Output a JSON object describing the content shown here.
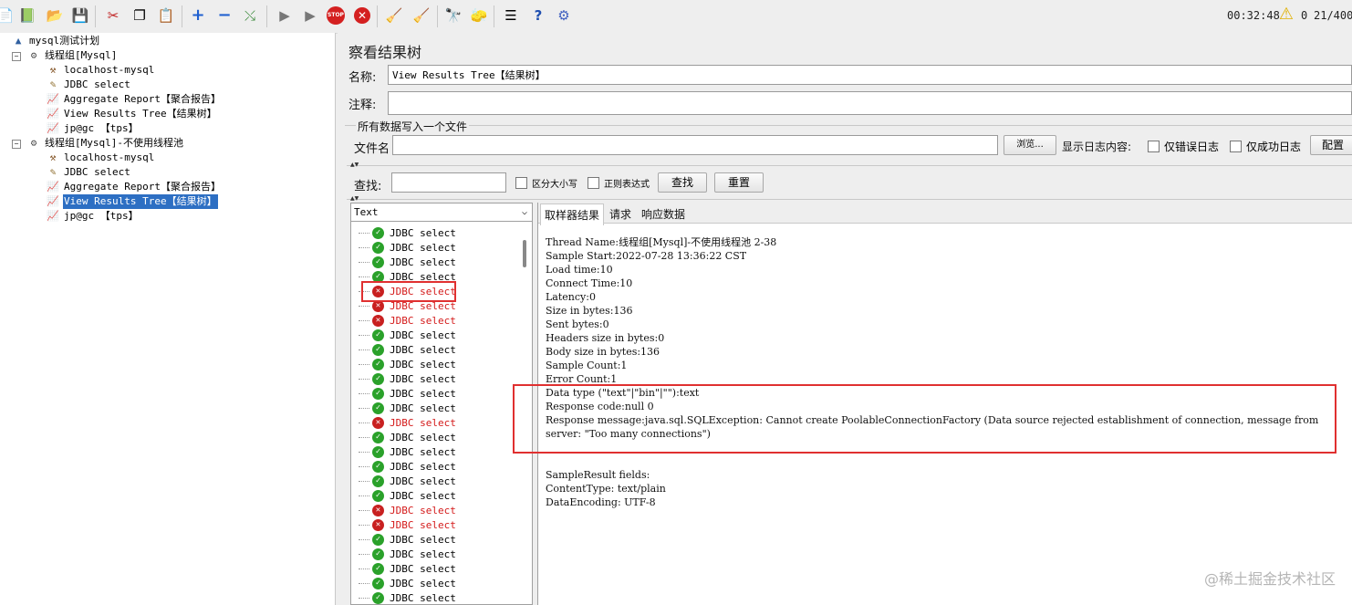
{
  "toolbar": {
    "icons": [
      "new-icon",
      "templates-icon",
      "open-icon",
      "save-icon",
      "cut-icon",
      "copy-icon",
      "paste-icon",
      "expand-icon",
      "collapse-icon",
      "toggle-icon",
      "start-icon",
      "start-no-pause-icon",
      "stop-icon",
      "shutdown-icon",
      "clear-icon",
      "clear-all-icon",
      "search-icon",
      "reset-search-icon",
      "function-helper-icon",
      "help-icon",
      "remote-icon"
    ],
    "elapsed": "00:32:48",
    "warning_count": "0",
    "threads": "21/400"
  },
  "tree": {
    "items": [
      {
        "label": "mysql测试计划",
        "icon": "test-plan-icon"
      },
      {
        "label": "线程组[Mysql]",
        "icon": "thread-group-icon"
      },
      {
        "label": "localhost-mysql",
        "icon": "config-icon"
      },
      {
        "label": "JDBC select",
        "icon": "sampler-icon"
      },
      {
        "label": "Aggregate Report【聚合报告】",
        "icon": "listener-icon"
      },
      {
        "label": "View Results Tree【结果树】",
        "icon": "listener-icon"
      },
      {
        "label": "jp@gc 【tps】",
        "icon": "listener-icon"
      },
      {
        "label": "线程组[Mysql]-不使用线程池",
        "icon": "thread-group-icon"
      },
      {
        "label": "localhost-mysql",
        "icon": "config-icon"
      },
      {
        "label": "JDBC select",
        "icon": "sampler-icon"
      },
      {
        "label": "Aggregate Report【聚合报告】",
        "icon": "listener-icon"
      },
      {
        "label": "View Results Tree【结果树】",
        "icon": "listener-icon"
      },
      {
        "label": "jp@gc 【tps】",
        "icon": "listener-icon"
      }
    ]
  },
  "panel": {
    "title": "察看结果树",
    "name_label": "名称:",
    "name_value": "View Results Tree【结果树】",
    "comment_label": "注释:",
    "comment_value": "",
    "file_group": "所有数据写入一个文件",
    "file_label": "文件名",
    "browse": "浏览...",
    "log_display": "显示日志内容:",
    "errors_only": "仅错误日志",
    "success_only": "仅成功日志",
    "config": "配置",
    "search_label": "查找:",
    "case_sensitive": "区分大小写",
    "regex": "正则表达式",
    "find_btn": "查找",
    "reset_btn": "重置",
    "renderer": "Text"
  },
  "results": [
    {
      "label": "JDBC select",
      "status": "ok"
    },
    {
      "label": "JDBC select",
      "status": "ok"
    },
    {
      "label": "JDBC select",
      "status": "ok"
    },
    {
      "label": "JDBC select",
      "status": "ok"
    },
    {
      "label": "JDBC select",
      "status": "error"
    },
    {
      "label": "JDBC select",
      "status": "error"
    },
    {
      "label": "JDBC select",
      "status": "error"
    },
    {
      "label": "JDBC select",
      "status": "ok"
    },
    {
      "label": "JDBC select",
      "status": "ok"
    },
    {
      "label": "JDBC select",
      "status": "ok"
    },
    {
      "label": "JDBC select",
      "status": "ok"
    },
    {
      "label": "JDBC select",
      "status": "ok"
    },
    {
      "label": "JDBC select",
      "status": "ok"
    },
    {
      "label": "JDBC select",
      "status": "error"
    },
    {
      "label": "JDBC select",
      "status": "ok"
    },
    {
      "label": "JDBC select",
      "status": "ok"
    },
    {
      "label": "JDBC select",
      "status": "ok"
    },
    {
      "label": "JDBC select",
      "status": "ok"
    },
    {
      "label": "JDBC select",
      "status": "ok"
    },
    {
      "label": "JDBC select",
      "status": "error"
    },
    {
      "label": "JDBC select",
      "status": "error"
    },
    {
      "label": "JDBC select",
      "status": "ok"
    },
    {
      "label": "JDBC select",
      "status": "ok"
    },
    {
      "label": "JDBC select",
      "status": "ok"
    },
    {
      "label": "JDBC select",
      "status": "ok"
    },
    {
      "label": "JDBC select",
      "status": "ok"
    }
  ],
  "detail_tabs": [
    "取样器结果",
    "请求",
    "响应数据"
  ],
  "detail_lines": [
    "Thread Name:线程组[Mysql]-不使用线程池 2-38",
    "Sample Start:2022-07-28 13:36:22 CST",
    "Load time:10",
    "Connect Time:10",
    "Latency:0",
    "Size in bytes:136",
    "Sent bytes:0",
    "Headers size in bytes:0",
    "Body size in bytes:136",
    "Sample Count:1",
    "Error Count:1",
    "Data type (\"text\"|\"bin\"|\"\"):text",
    "Response code:null 0",
    "Response message:java.sql.SQLException: Cannot create PoolableConnectionFactory (Data source rejected establishment of connection,  message from",
    "server: \"Too many connections\")",
    "",
    "",
    "SampleResult fields:",
    "ContentType: text/plain",
    "DataEncoding: UTF-8"
  ],
  "watermark": "@稀土掘金技术社区",
  "colors": {
    "selection": "#2d6fc3",
    "error": "#d41a1a",
    "ok": "#2aa12a",
    "highlight": "#e03030"
  }
}
